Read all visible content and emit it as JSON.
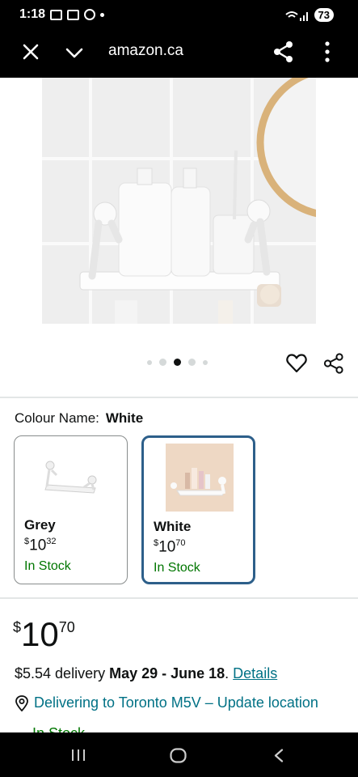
{
  "status": {
    "time": "1:18",
    "battery": "73"
  },
  "browser": {
    "url": "amazon.ca"
  },
  "colour": {
    "label": "Colour Name:",
    "selected": "White"
  },
  "swatches": [
    {
      "name": "Grey",
      "currency": "$",
      "whole": "10",
      "cents": "32",
      "stock": "In Stock"
    },
    {
      "name": "White",
      "currency": "$",
      "whole": "10",
      "cents": "70",
      "stock": "In Stock"
    }
  ],
  "price": {
    "currency": "$",
    "whole": "10",
    "cents": "70"
  },
  "delivery": {
    "prefix": "$5.54 delivery ",
    "dates": "May 29 - June 18",
    "suffix": ". ",
    "details": "Details"
  },
  "location": {
    "text": "Delivering to Toronto M5V – Update location"
  },
  "partial_text": "In Stock",
  "colors": {
    "link": "#007185",
    "in_stock": "#007600",
    "selected_border": "#2d5f8a"
  }
}
